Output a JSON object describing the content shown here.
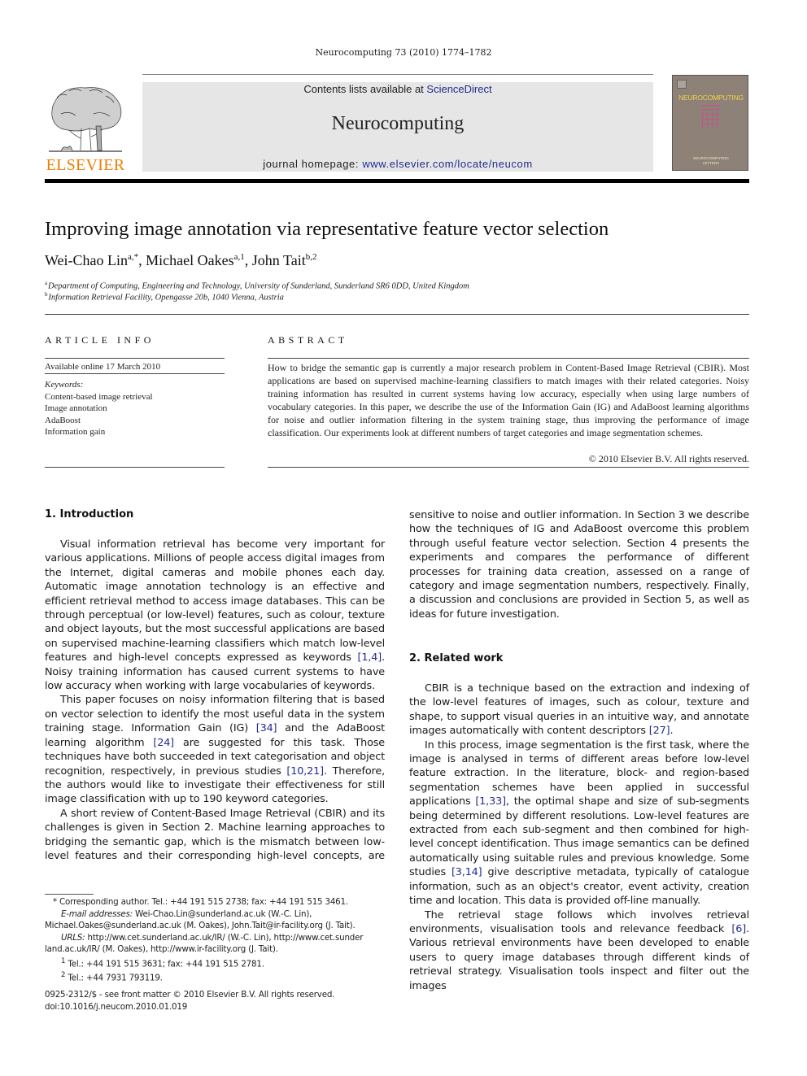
{
  "running_head": "Neurocomputing 73 (2010) 1774–1782",
  "header": {
    "publisher_logo_text": "ELSEVIER",
    "contents_prefix": "Contents lists available at ",
    "contents_link": "ScienceDirect",
    "journal_name": "Neurocomputing",
    "homepage_prefix": "journal homepage: ",
    "homepage_link": "www.elsevier.com/locate/neucom",
    "cover_title": "NEUROCOMPUTING",
    "cover_subtitle_line1": "NEUROCOMPUTING",
    "cover_subtitle_line2": "LETTERS",
    "colors": {
      "elsevier_orange": "#f07d00",
      "link_blue": "#1f2b8f",
      "banner_gray": "#e6e6e6",
      "cover_brown": "#8d8178"
    }
  },
  "article": {
    "title": "Improving image annotation via representative feature vector selection",
    "authors": [
      {
        "name": "Wei-Chao Lin",
        "sup": "a,*",
        "sep": ", "
      },
      {
        "name": "Michael Oakes",
        "sup": "a,1",
        "sep": ", "
      },
      {
        "name": "John Tait",
        "sup": "b,2",
        "sep": ""
      }
    ],
    "affiliations": [
      {
        "sup": "a",
        "text": "Department of Computing, Engineering and Technology, University of Sunderland, Sunderland SR6 0DD, United Kingdom"
      },
      {
        "sup": "b",
        "text": "Information Retrieval Facility, Opengasse 20b, 1040 Vienna, Austria"
      }
    ]
  },
  "article_info": {
    "heading": "ARTICLE INFO",
    "available_online": "Available online 17 March 2010",
    "keywords_label": "Keywords:",
    "keywords": [
      "Content-based image retrieval",
      "Image annotation",
      "AdaBoost",
      "Information gain"
    ]
  },
  "abstract": {
    "heading": "ABSTRACT",
    "text": "How to bridge the semantic gap is currently a major research problem in Content-Based Image Retrieval (CBIR). Most applications are based on supervised machine-learning classifiers to match images with their related categories. Noisy training information has resulted in current systems having low accuracy, especially when using large numbers of vocabulary categories. In this paper, we describe the use of the Information Gain (IG) and AdaBoost learning algorithms for noise and outlier information filtering in the system training stage, thus improving the performance of image classification. Our experiments look at different numbers of target categories and image segmentation schemes.",
    "copyright": "© 2010 Elsevier B.V. All rights reserved."
  },
  "sections": {
    "intro": {
      "heading": "1.  Introduction",
      "p1_a": "Visual information retrieval has become very important for various applications. Millions of people access digital images from the Internet, digital cameras and mobile phones each day. Automatic image annotation technology is an effective and efficient retrieval method to access image databases. This can be through perceptual (or low-level) features, such as colour, texture and object layouts, but the most successful applications are based on supervised machine-learning classifiers which match low-level features and high-level concepts expressed as keywords ",
      "p1_cite": "[1,4]",
      "p1_b": ". Noisy training information has caused current systems to have low accuracy when working with large vocabularies of keywords.",
      "p2_a": "This paper focuses on noisy information filtering that is based on vector selection to identify the most useful data in the system training stage. Information Gain (IG) ",
      "p2_cite1": "[34]",
      "p2_b": " and the AdaBoost learning algorithm ",
      "p2_cite2": "[24]",
      "p2_c": " are suggested for this task. Those techniques have both succeeded in text categorisation and object recognition, respectively, in previous studies ",
      "p2_cite3": "[10,21]",
      "p2_d": ". Therefore, the authors would like to investigate their effectiveness for still image classification with up to 190 keyword categories.",
      "p3": "A short review of Content-Based Image Retrieval (CBIR) and its challenges is given in Section 2. Machine learning approaches to bridging the semantic gap, which is the mismatch between low-level features and their corresponding high-level concepts, are",
      "p3_cont": "sensitive to noise and outlier information. In Section 3 we describe how the techniques of IG and AdaBoost overcome this problem through useful feature vector selection. Section 4 presents the experiments and compares the performance of different processes for training data creation, assessed on a range of category and image segmentation numbers, respectively. Finally, a discussion and conclusions are provided in Section 5, as well as ideas for future investigation."
    },
    "related": {
      "heading": "2.  Related work",
      "p1_a": "CBIR is a technique based on the extraction and indexing of the low-level features of images, such as colour, texture and shape, to support visual queries in an intuitive way, and annotate images automatically with content descriptors ",
      "p1_cite": "[27]",
      "p1_b": ".",
      "p2_a": "In this process, image segmentation is the first task, where the image is analysed in terms of different areas before low-level feature extraction. In the literature, block- and region-based segmentation schemes have been applied in successful applications ",
      "p2_cite1": "[1,33]",
      "p2_b": ", the optimal shape and size of sub-segments being determined by different resolutions. Low-level features are extracted from each sub-segment and then combined for high-level concept identification. Thus image semantics can be defined automatically using suitable rules and previous knowledge. Some studies ",
      "p2_cite2": "[3,14]",
      "p2_c": " give descriptive metadata, typically of catalogue information, such as an object's creator, event activity, creation time and location. This data is provided off-line manually.",
      "p3_a": "The retrieval stage follows which involves retrieval environments, visualisation tools and relevance feedback ",
      "p3_cite": "[6]",
      "p3_b": ". Various retrieval environments have been developed to enable users to query image databases through different kinds of retrieval strategy. Visualisation tools inspect and filter out the images"
    }
  },
  "footnotes": {
    "corresponding": "* Corresponding author. Tel.: +44 191 515 2738; fax: +44 191 515 3461.",
    "email_label": "E-mail addresses:",
    "email_line1": " Wei-Chao.Lin@sunderland.ac.uk (W.-C. Lin),",
    "email_line2": "Michael.Oakes@sunderland.ac.uk (M. Oakes), John.Tait@ir-facility.org (J. Tait).",
    "urls_label": "URLS:",
    "urls_line1": " http://ww.cet.sunderland.ac.uk/IR/ (W.-C. Lin), http://www.cet.sunder",
    "urls_line2": "land.ac.uk/IR/ (M. Oakes), http://www.ir-facility.org (J. Tait).",
    "fn1": "Tel.: +44 191 515 3631; fax: +44 191 515 2781.",
    "fn1_mark": "1",
    "fn2": "Tel.: +44 7931 793119.",
    "fn2_mark": "2"
  },
  "front_matter": {
    "issn_line": "0925-2312/$ - see front matter © 2010 Elsevier B.V. All rights reserved.",
    "doi": "doi:10.1016/j.neucom.2010.01.019"
  }
}
